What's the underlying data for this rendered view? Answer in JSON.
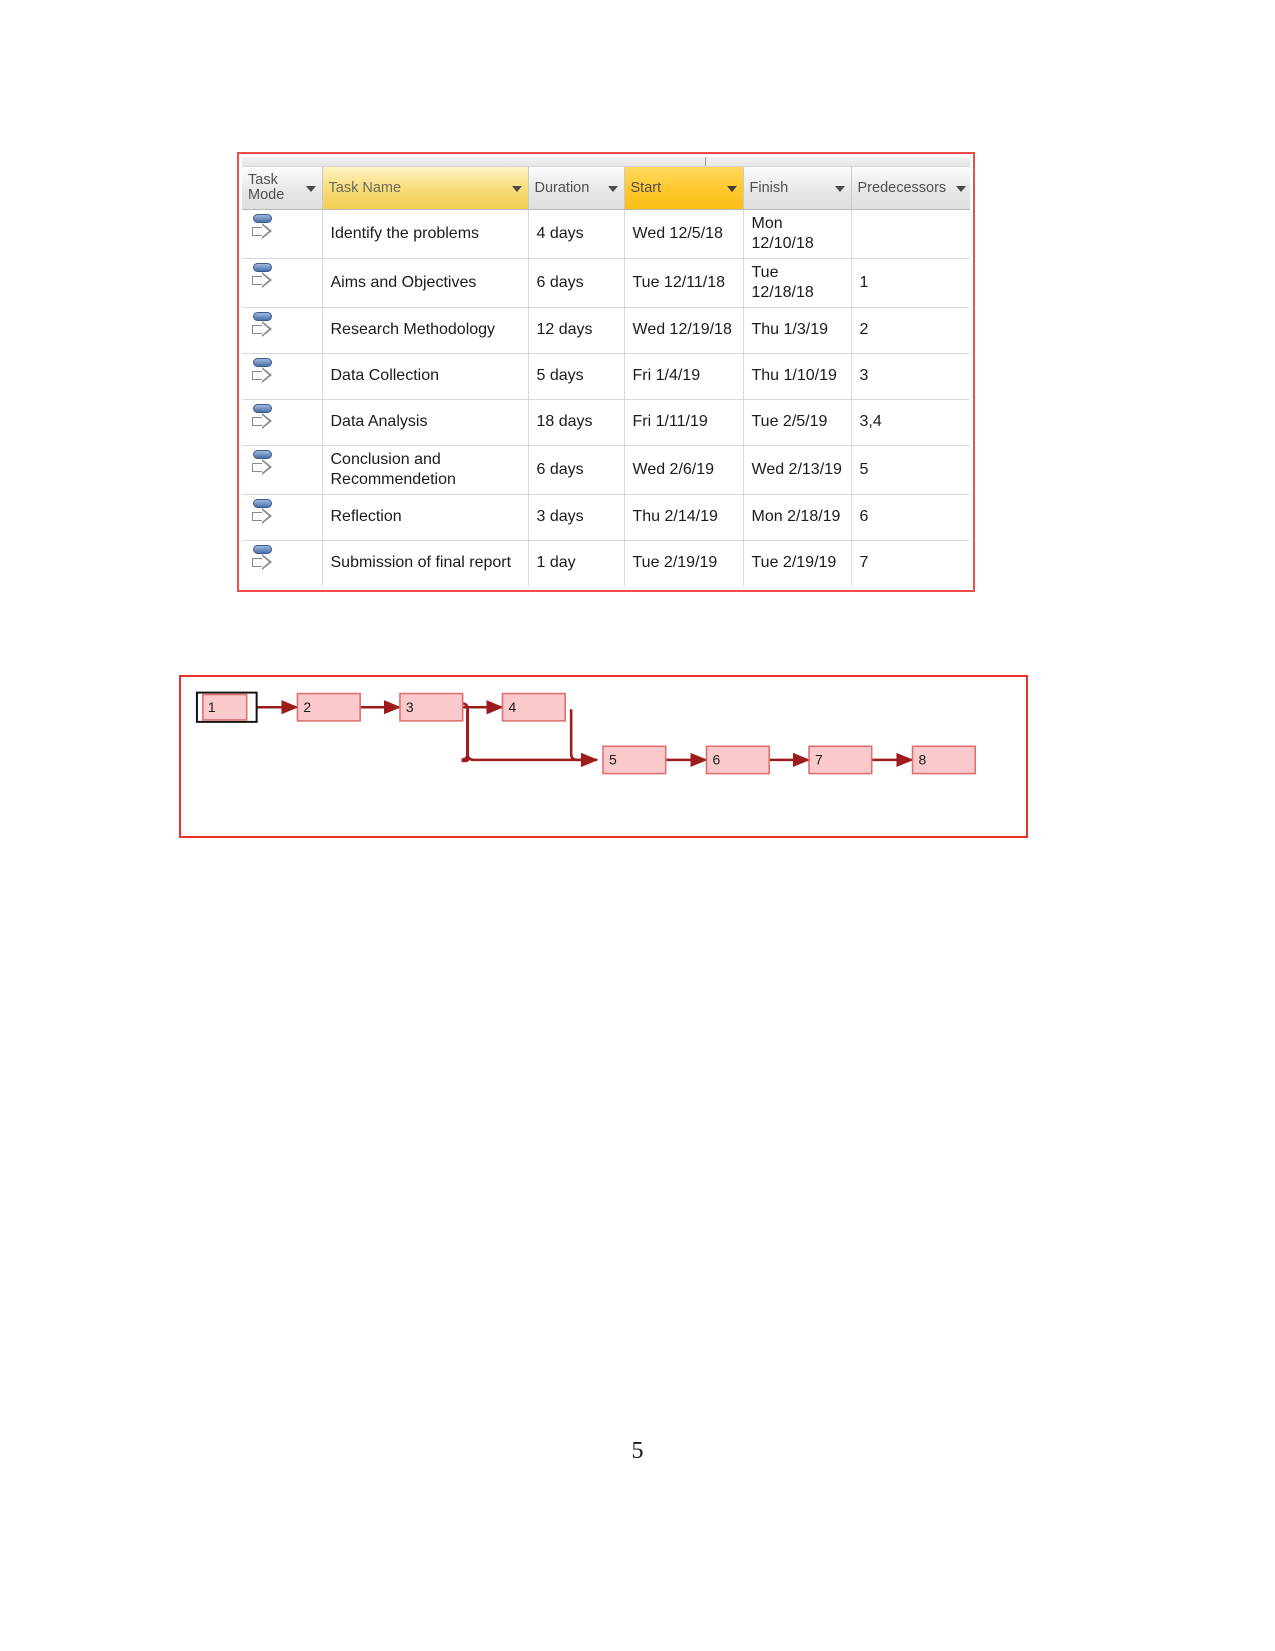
{
  "page": {
    "number": "5"
  },
  "task_table": {
    "columns": [
      {
        "label": "Task Mode",
        "icon": "chevron-down-icon",
        "highlight": "none"
      },
      {
        "label": "Task Name",
        "icon": "chevron-down-icon",
        "highlight": "light"
      },
      {
        "label": "Duration",
        "icon": "chevron-down-icon",
        "highlight": "none"
      },
      {
        "label": "Start",
        "icon": "chevron-down-icon",
        "highlight": "strong"
      },
      {
        "label": "Finish",
        "icon": "chevron-down-icon",
        "highlight": "none"
      },
      {
        "label": "Predecessors",
        "icon": "chevron-down-icon",
        "highlight": "none"
      }
    ],
    "rows": [
      {
        "mode_icon": "auto-scheduled-icon",
        "name": "Identify the problems",
        "duration": "4 days",
        "start": "Wed 12/5/18",
        "finish": "Mon 12/10/18",
        "predecessors": ""
      },
      {
        "mode_icon": "auto-scheduled-icon",
        "name": "Aims and Objectives",
        "duration": "6 days",
        "start": "Tue 12/11/18",
        "finish": "Tue 12/18/18",
        "predecessors": "1"
      },
      {
        "mode_icon": "auto-scheduled-icon",
        "name": "Research Methodology",
        "duration": "12 days",
        "start": "Wed 12/19/18",
        "finish": "Thu 1/3/19",
        "predecessors": "2"
      },
      {
        "mode_icon": "auto-scheduled-icon",
        "name": "Data Collection",
        "duration": "5 days",
        "start": "Fri 1/4/19",
        "finish": "Thu 1/10/19",
        "predecessors": "3"
      },
      {
        "mode_icon": "auto-scheduled-icon",
        "name": "Data Analysis",
        "duration": "18 days",
        "start": "Fri 1/11/19",
        "finish": "Tue 2/5/19",
        "predecessors": "3,4"
      },
      {
        "mode_icon": "auto-scheduled-icon",
        "name": "Conclusion and Recommendetion",
        "duration": "6 days",
        "start": "Wed 2/6/19",
        "finish": "Wed 2/13/19",
        "predecessors": "5"
      },
      {
        "mode_icon": "auto-scheduled-icon",
        "name": "Reflection",
        "duration": "3 days",
        "start": "Thu 2/14/19",
        "finish": "Mon 2/18/19",
        "predecessors": "6"
      },
      {
        "mode_icon": "auto-scheduled-icon",
        "name": "Submission of final report",
        "duration": "1 day",
        "start": "Tue 2/19/19",
        "finish": "Tue 2/19/19",
        "predecessors": "7"
      }
    ]
  },
  "network_diagram": {
    "nodes": [
      {
        "id": "1",
        "label": "1",
        "selected": true
      },
      {
        "id": "2",
        "label": "2",
        "selected": false
      },
      {
        "id": "3",
        "label": "3",
        "selected": false
      },
      {
        "id": "4",
        "label": "4",
        "selected": false
      },
      {
        "id": "5",
        "label": "5",
        "selected": false
      },
      {
        "id": "6",
        "label": "6",
        "selected": false
      },
      {
        "id": "7",
        "label": "7",
        "selected": false
      },
      {
        "id": "8",
        "label": "8",
        "selected": false
      }
    ],
    "edges": [
      {
        "from": "1",
        "to": "2"
      },
      {
        "from": "2",
        "to": "3"
      },
      {
        "from": "3",
        "to": "4"
      },
      {
        "from": "3",
        "to": "5"
      },
      {
        "from": "4",
        "to": "5"
      },
      {
        "from": "5",
        "to": "6"
      },
      {
        "from": "6",
        "to": "7"
      },
      {
        "from": "7",
        "to": "8"
      }
    ],
    "colors": {
      "node_fill": "#f9c9cb",
      "node_stroke": "#e0706f",
      "link": "#9e1b1b",
      "frame": "#e8332a"
    }
  }
}
